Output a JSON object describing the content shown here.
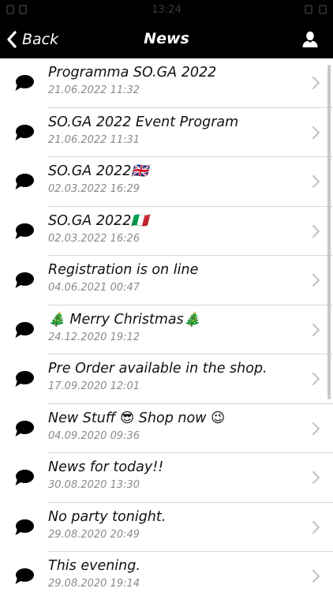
{
  "status_bar": {
    "time": "13:24"
  },
  "nav": {
    "back_label": "Back",
    "title": "News",
    "back_icon": "chevron-left-icon",
    "profile_icon": "user-icon"
  },
  "news": {
    "items": [
      {
        "title": "Programma SO.GA 2022",
        "date": "21.06.2022 11:32"
      },
      {
        "title": "SO.GA 2022 Event Program",
        "date": "21.06.2022 11:31"
      },
      {
        "title": "SO.GA 2022🇬🇧",
        "date": "02.03.2022 16:29"
      },
      {
        "title": "SO.GA 2022🇮🇹",
        "date": "02.03.2022 16:26"
      },
      {
        "title": "Registration is on line",
        "date": "04.06.2021 00:47"
      },
      {
        "title": "🎄 Merry Christmas🎄",
        "date": "24.12.2020 19:12"
      },
      {
        "title": "Pre Order available in the shop.",
        "date": "17.09.2020 12:01"
      },
      {
        "title": "New Stuff 😎  Shop now 😉",
        "date": "04.09.2020 09:36"
      },
      {
        "title": "News for today!!",
        "date": "30.08.2020 13:30"
      },
      {
        "title": "No party tonight.",
        "date": "29.08.2020 20:49"
      },
      {
        "title": "This evening.",
        "date": "29.08.2020 19:14"
      }
    ],
    "item_icon": "speech-bubble-icon",
    "chevron_icon": "chevron-right-icon"
  },
  "colors": {
    "bar_background": "#000000",
    "bar_text": "#ffffff",
    "title_text": "#111111",
    "date_text": "#8a8a8a",
    "separator": "#d6d6d6",
    "chevron": "#c4c4c4"
  }
}
